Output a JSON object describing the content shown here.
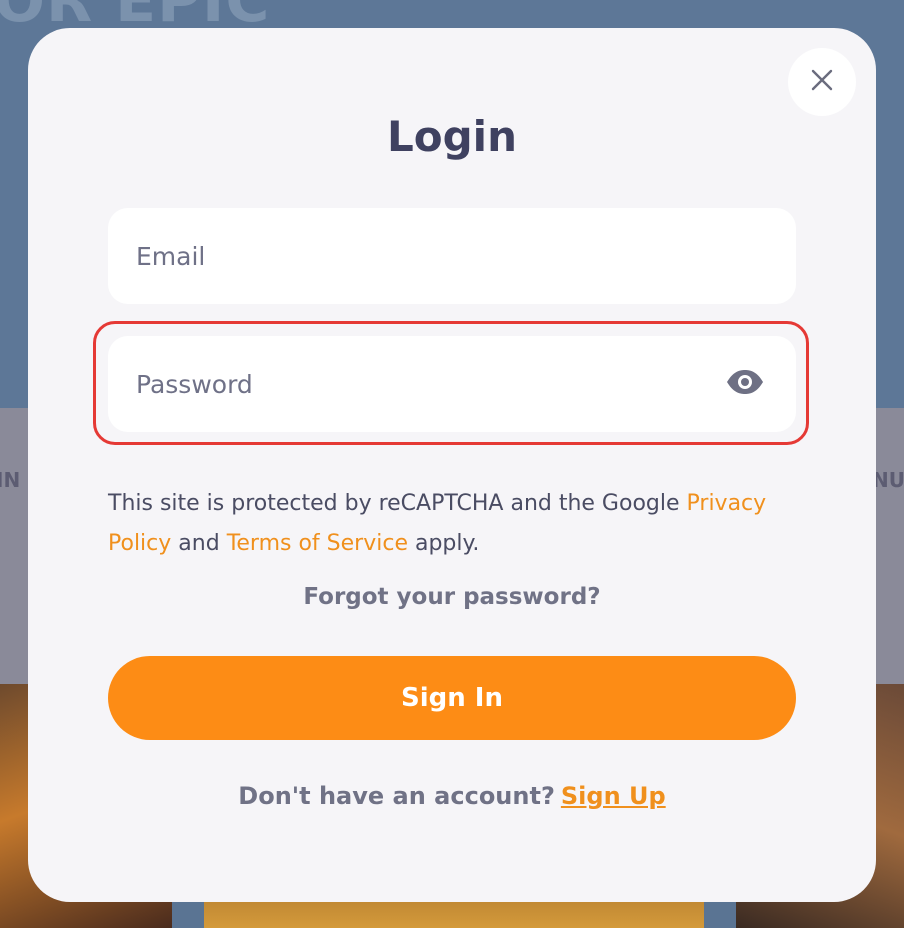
{
  "background": {
    "hero_text": "OR EPIC",
    "strip_left_text": "IN",
    "strip_right_text": "NU"
  },
  "modal": {
    "title": "Login",
    "close_icon": "close-icon",
    "email": {
      "placeholder": "Email",
      "value": ""
    },
    "password": {
      "placeholder": "Password",
      "value": "",
      "toggle_icon": "eye-icon"
    },
    "notice": {
      "text_before": "This site is protected by reCAPTCHA and the Google ",
      "privacy_link": "Privacy Policy",
      "text_middle": " and ",
      "terms_link": "Terms of Service",
      "text_after": " apply."
    },
    "forgot_label": "Forgot your password?",
    "signin_label": "Sign In",
    "signup_prompt": "Don't have an account?",
    "signup_link": "Sign Up"
  },
  "colors": {
    "accent": "#fd8c15",
    "link": "#f0901d",
    "title": "#3f4160",
    "highlight": "#e53935",
    "modal_bg": "#f6f5f8"
  }
}
